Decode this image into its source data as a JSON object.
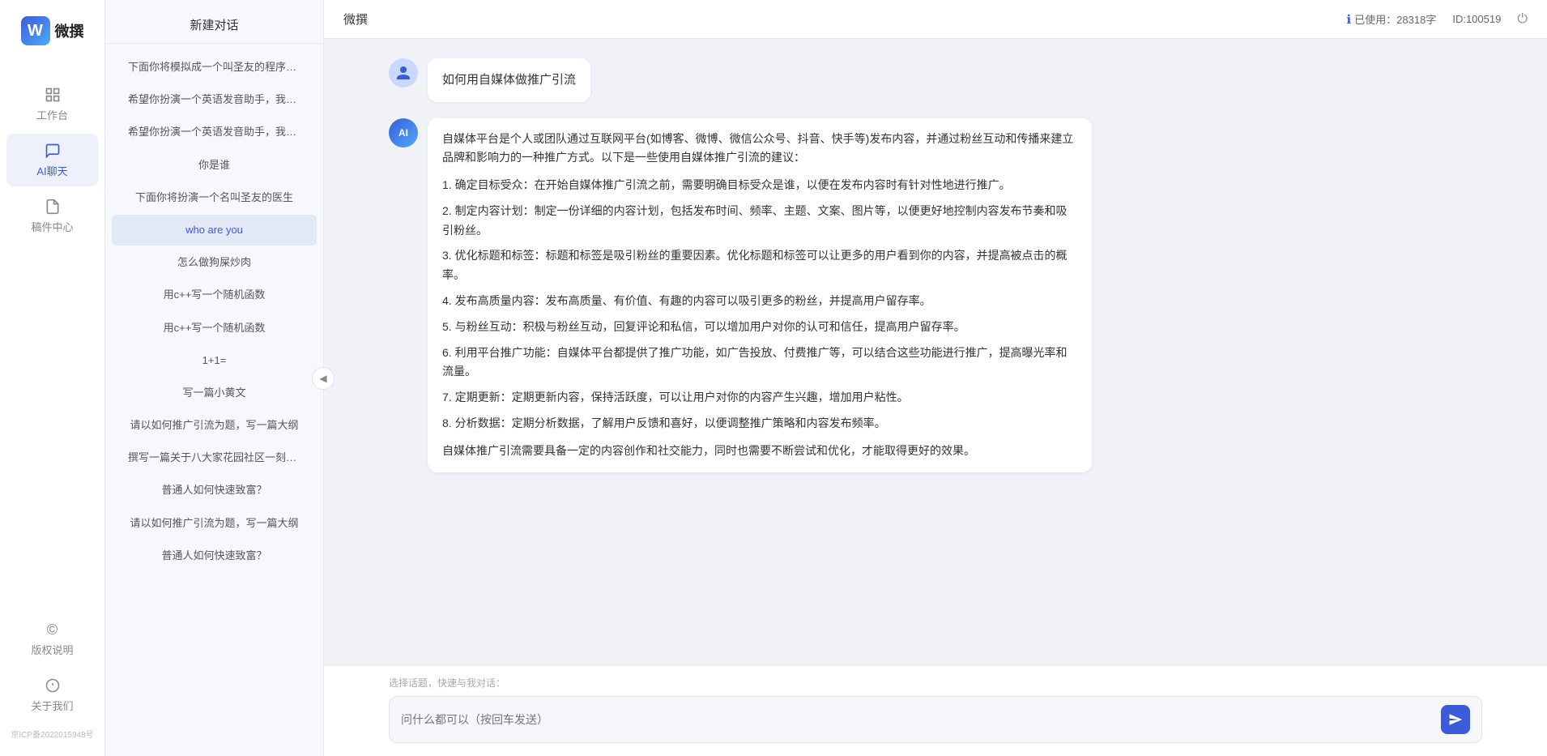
{
  "app": {
    "name": "微撰",
    "logo_letter": "W"
  },
  "topbar": {
    "title": "微撰",
    "usage_label": "已使用：28318字",
    "usage_icon": "info-icon",
    "id_label": "ID:100519",
    "logout_icon": "power-icon"
  },
  "nav": {
    "items": [
      {
        "id": "workspace",
        "label": "工作台",
        "icon": "grid-icon"
      },
      {
        "id": "ai-chat",
        "label": "AI聊天",
        "icon": "chat-icon",
        "active": true
      },
      {
        "id": "parts-center",
        "label": "稿件中心",
        "icon": "doc-icon"
      }
    ],
    "bottom_items": [
      {
        "id": "copyright",
        "label": "版权说明",
        "icon": "copyright-icon"
      },
      {
        "id": "about",
        "label": "关于我们",
        "icon": "info-circle-icon"
      }
    ],
    "icp": "京ICP备2022015948号"
  },
  "sidebar": {
    "header": "新建对话",
    "items": [
      {
        "id": "item1",
        "label": "下面你将模拟成一个叫圣友的程序员，我说...",
        "active": false
      },
      {
        "id": "item2",
        "label": "希望你扮演一个英语发音助手，我提供给你...",
        "active": false
      },
      {
        "id": "item3",
        "label": "希望你扮演一个英语发音助手，我提供给你...",
        "active": false
      },
      {
        "id": "item4",
        "label": "你是谁",
        "active": false
      },
      {
        "id": "item5",
        "label": "下面你将扮演一个名叫圣友的医生",
        "active": false
      },
      {
        "id": "item6",
        "label": "who are you",
        "active": true
      },
      {
        "id": "item7",
        "label": "怎么做狗屎炒肉",
        "active": false
      },
      {
        "id": "item8",
        "label": "用c++写一个随机函数",
        "active": false
      },
      {
        "id": "item9",
        "label": "用c++写一个随机函数",
        "active": false
      },
      {
        "id": "item10",
        "label": "1+1=",
        "active": false
      },
      {
        "id": "item11",
        "label": "写一篇小黄文",
        "active": false
      },
      {
        "id": "item12",
        "label": "请以如何推广引流为题，写一篇大纲",
        "active": false
      },
      {
        "id": "item13",
        "label": "撰写一篇关于八大家花园社区一刻钟便民生...",
        "active": false
      },
      {
        "id": "item14",
        "label": "普通人如何快速致富？",
        "active": false
      },
      {
        "id": "item15",
        "label": "请以如何推广引流为题，写一篇大纲",
        "active": false
      },
      {
        "id": "item16",
        "label": "普通人如何快速致富？",
        "active": false
      }
    ]
  },
  "chat": {
    "messages": [
      {
        "role": "user",
        "text": "如何用自媒体做推广引流",
        "avatar_type": "user"
      },
      {
        "role": "ai",
        "avatar_type": "ai",
        "paragraphs": [
          "自媒体平台是个人或团队通过互联网平台(如博客、微博、微信公众号、抖音、快手等)发布内容，并通过粉丝互动和传播来建立品牌和影响力的一种推广方式。以下是一些使用自媒体推广引流的建议：",
          "1. 确定目标受众：在开始自媒体推广引流之前，需要明确目标受众是谁，以便在发布内容时有针对性地进行推广。",
          "2. 制定内容计划：制定一份详细的内容计划，包括发布时间、频率、主题、文案、图片等，以便更好地控制内容发布节奏和吸引粉丝。",
          "3. 优化标题和标签：标题和标签是吸引粉丝的重要因素。优化标题和标签可以让更多的用户看到你的内容，并提高被点击的概率。",
          "4. 发布高质量内容：发布高质量、有价值、有趣的内容可以吸引更多的粉丝，并提高用户留存率。",
          "5. 与粉丝互动：积极与粉丝互动，回复评论和私信，可以增加用户对你的认可和信任，提高用户留存率。",
          "6. 利用平台推广功能：自媒体平台都提供了推广功能，如广告投放、付费推广等，可以结合这些功能进行推广，提高曝光率和流量。",
          "7. 定期更新：定期更新内容，保持活跃度，可以让用户对你的内容产生兴趣，增加用户粘性。",
          "8. 分析数据：定期分析数据，了解用户反馈和喜好，以便调整推广策略和内容发布频率。",
          "自媒体推广引流需要具备一定的内容创作和社交能力，同时也需要不断尝试和优化，才能取得更好的效果。"
        ]
      }
    ],
    "quick_prompt_label": "选择话题，快速与我对话：",
    "input_placeholder": "问什么都可以（按回车发送）",
    "send_icon": "send-icon"
  }
}
